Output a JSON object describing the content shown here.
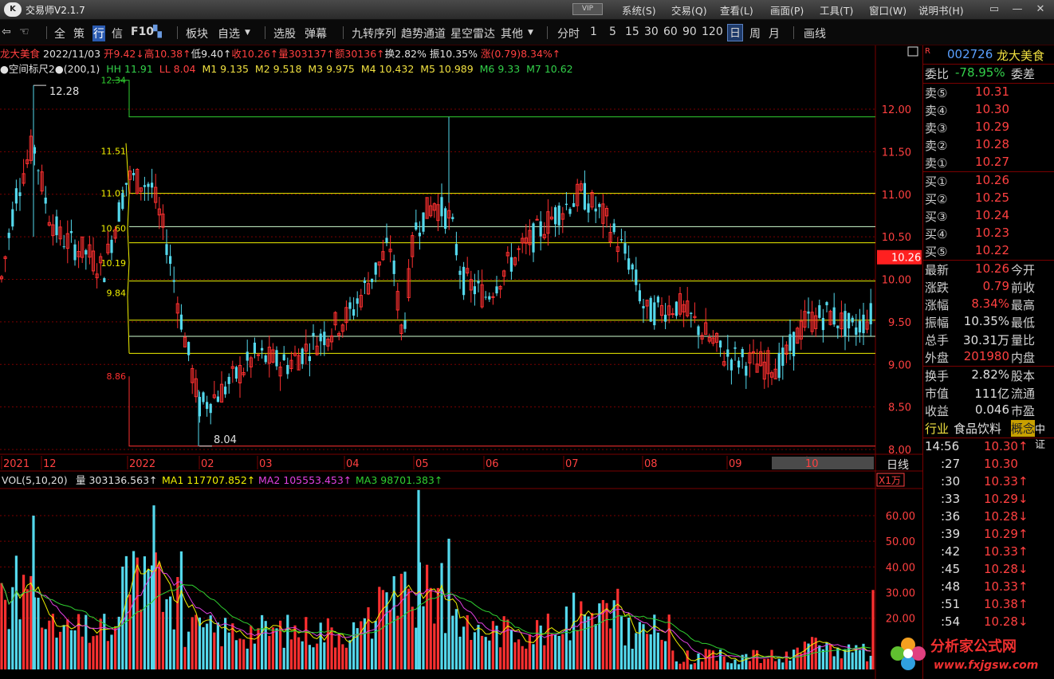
{
  "window": {
    "app_title": "交易师V2.1.7",
    "vip_label": "VIP",
    "menu": [
      "系统(S)",
      "交易(Q)",
      "查看(L)",
      "画面(P)",
      "工具(T)",
      "窗口(W)",
      "说明书(H)"
    ]
  },
  "toolbar": {
    "nav_items": [
      "全",
      "策",
      "行",
      "信",
      "F10"
    ],
    "items": [
      "板块",
      "自选",
      "选股",
      "弹幕",
      "九转序列",
      "趋势通道",
      "星空雷达",
      "其他"
    ],
    "periods": [
      "分时",
      "1",
      "5",
      "15",
      "30",
      "60",
      "90",
      "120",
      "日",
      "周",
      "月"
    ],
    "active_period": "日",
    "draw_label": "画线"
  },
  "info": {
    "name": "龙大美食",
    "date": "2022/11/03",
    "open": "开9.42↓",
    "high": "高10.38↑",
    "low": "低9.40↑",
    "close": "收10.26↑",
    "volume": "量303137↑",
    "amount": "额30136↑",
    "turnover": "换2.82%",
    "amplitude": "振10.35%",
    "change": "涨(0.79)8.34%↑"
  },
  "indicator": {
    "name": "●空间标尺2●(200,1)",
    "hh": "HH 11.91",
    "ll": "LL 8.04",
    "m1": "M1 9.135",
    "m2": "M2 9.518",
    "m3": "M3 9.975",
    "m4": "M4 10.432",
    "m5": "M5 10.989",
    "m6": "M6 9.33",
    "m7": "M7 10.62"
  },
  "price_axis": [
    "12.00",
    "11.50",
    "11.00",
    "10.50",
    "10.00",
    "9.50",
    "9.00",
    "8.50",
    "8.00"
  ],
  "price_tag": "10.26",
  "left_labels": [
    "12.34",
    "11.51",
    "11.01",
    "10.60",
    "10.19",
    "9.84",
    "8.86"
  ],
  "peak_label": "12.28",
  "trough_label": "8.04",
  "date_axis": [
    "2021",
    "12",
    "2022",
    "02",
    "03",
    "04",
    "05",
    "06",
    "07",
    "08",
    "09",
    "10"
  ],
  "period_label": "日线",
  "volume_panel": {
    "title": "VOL(5,10,20)",
    "vol": "量 303136.563↑",
    "ma1": "MA1 117707.852↑",
    "ma2": "MA2 105553.453↑",
    "ma3": "MA3 98701.383↑",
    "unit": "X1万",
    "axis": [
      "60.00",
      "50.00",
      "40.00",
      "30.00",
      "20.00"
    ]
  },
  "quote": {
    "code": "002726",
    "name": "龙大美食",
    "r_flag": "R",
    "ratio_label": "委比",
    "ratio_value": "-78.95%",
    "diff_label": "委差",
    "asks": [
      {
        "label": "卖⑤",
        "price": "10.31"
      },
      {
        "label": "卖④",
        "price": "10.30"
      },
      {
        "label": "卖③",
        "price": "10.29"
      },
      {
        "label": "卖②",
        "price": "10.28"
      },
      {
        "label": "卖①",
        "price": "10.27"
      }
    ],
    "bids": [
      {
        "label": "买①",
        "price": "10.26"
      },
      {
        "label": "买②",
        "price": "10.25"
      },
      {
        "label": "买③",
        "price": "10.24"
      },
      {
        "label": "买④",
        "price": "10.23"
      },
      {
        "label": "买⑤",
        "price": "10.22"
      }
    ],
    "stats": [
      {
        "l": "最新",
        "v": "10.26",
        "r": "今开",
        "c": "#ff4040"
      },
      {
        "l": "涨跌",
        "v": "0.79",
        "r": "前收",
        "c": "#ff4040"
      },
      {
        "l": "涨幅",
        "v": "8.34%",
        "r": "最高",
        "c": "#ff4040"
      },
      {
        "l": "振幅",
        "v": "10.35%",
        "r": "最低",
        "c": "#e0e0e0"
      },
      {
        "l": "总手",
        "v": "30.31万",
        "r": "量比",
        "c": "#e0e0e0"
      },
      {
        "l": "外盘",
        "v": "201980",
        "r": "内盘",
        "c": "#ff4040"
      }
    ],
    "stats2": [
      {
        "l": "换手",
        "v": "2.82%",
        "r": "股本"
      },
      {
        "l": "市值",
        "v": "111亿",
        "r": "流通"
      },
      {
        "l": "收益",
        "v": "0.046",
        "r": "市盈"
      }
    ],
    "industry_label": "行业",
    "industry": "食品饮料",
    "concept_label": "概念",
    "concept_extra": "中证",
    "ticks": [
      {
        "t": "14:56",
        "p": "10.30↑",
        "c": "#ff4040"
      },
      {
        "t": ":27",
        "p": "10.30",
        "c": "#ff4040"
      },
      {
        "t": ":30",
        "p": "10.33↑",
        "c": "#ff4040"
      },
      {
        "t": ":33",
        "p": "10.29↓",
        "c": "#ff4040"
      },
      {
        "t": ":36",
        "p": "10.28↓",
        "c": "#ff4040"
      },
      {
        "t": ":39",
        "p": "10.29↑",
        "c": "#ff4040"
      },
      {
        "t": ":42",
        "p": "10.33↑",
        "c": "#ff4040"
      },
      {
        "t": ":45",
        "p": "10.28↓",
        "c": "#ff4040"
      },
      {
        "t": ":48",
        "p": "10.33↑",
        "c": "#ff4040"
      },
      {
        "t": ":51",
        "p": "10.38↑",
        "c": "#ff4040"
      },
      {
        "t": ":54",
        "p": "10.28↓",
        "c": "#ff4040"
      }
    ]
  },
  "watermark": {
    "text": "分析家公式网",
    "url": "www.fxjgsw.com"
  },
  "colors": {
    "up": "#ff3030",
    "down": "#54d8ec",
    "grid": "#7a0000",
    "ma1": "#f0f000",
    "ma2": "#e040e0",
    "ma3": "#30d030"
  }
}
